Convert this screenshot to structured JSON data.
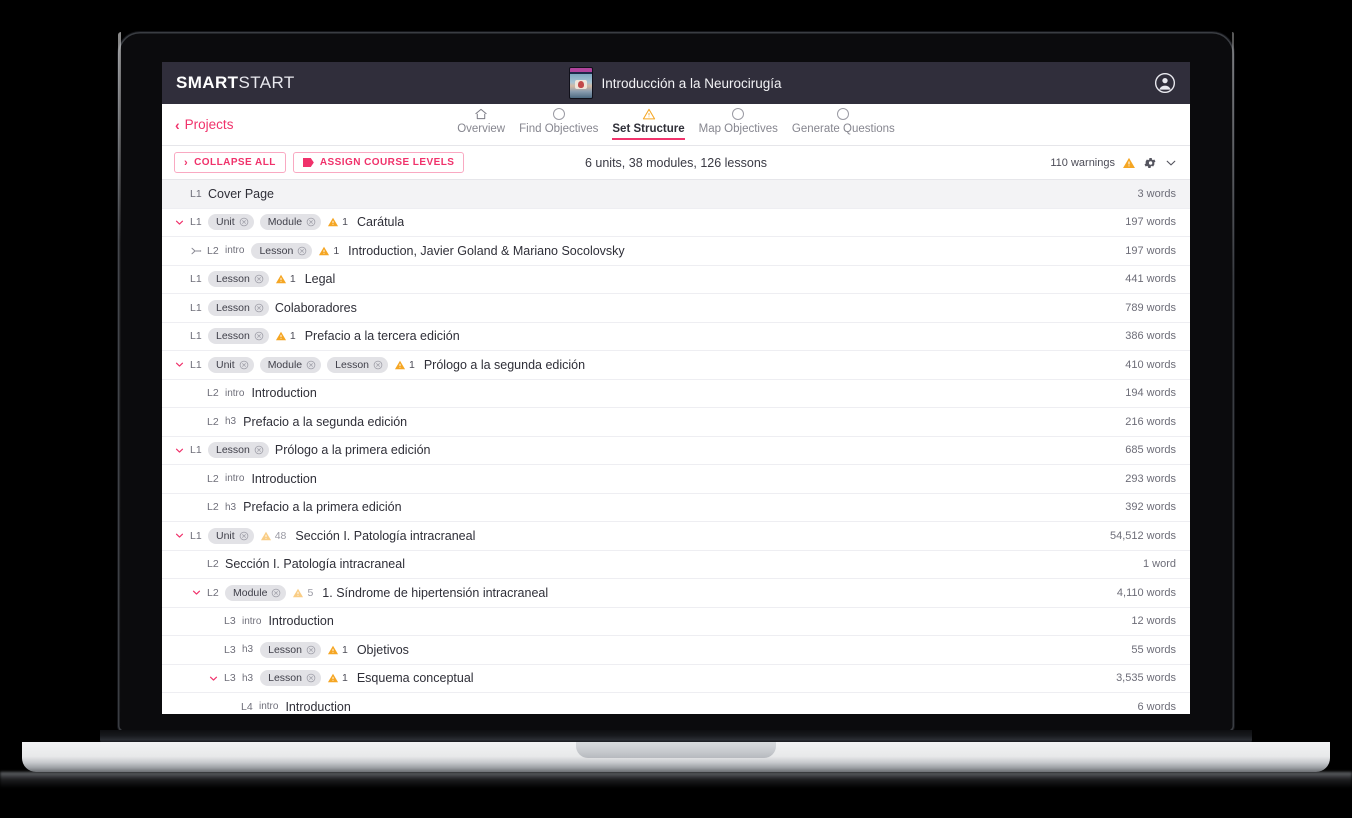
{
  "app": {
    "brand_strong": "SMART",
    "brand_light": "START",
    "course_title": "Introducción a la Neurocirugía",
    "account_icon": "account-circle-icon",
    "book_thumb_icon": "book-cover-thumbnail"
  },
  "nav": {
    "back_label": "Projects",
    "back_chevron": "‹",
    "steps": [
      {
        "label": "Overview",
        "icon": "home-icon",
        "state": "done"
      },
      {
        "label": "Find Objectives",
        "icon": "circle-icon",
        "state": "idle"
      },
      {
        "label": "Set Structure",
        "icon": "warning-triangle-icon",
        "state": "active"
      },
      {
        "label": "Map Objectives",
        "icon": "circle-icon",
        "state": "idle"
      },
      {
        "label": "Generate Questions",
        "icon": "circle-icon",
        "state": "idle"
      }
    ]
  },
  "toolbar": {
    "collapse_all_label": "COLLAPSE ALL",
    "collapse_chevron": "›",
    "assign_levels_label": "ASSIGN COURSE LEVELS",
    "assign_icon": "tag-icon",
    "summary": "6 units, 38 modules, 126 lessons",
    "warnings_label": "110 warnings",
    "warning_icon": "warning-triangle-icon",
    "settings_icon": "gear-icon",
    "collapse_panel_icon": "chevron-down-icon"
  },
  "colors": {
    "brand_pink": "#f0326b",
    "topbar": "#302e3b",
    "warning_orange": "#f5a623",
    "chip_bg": "#e2e2e6",
    "row_shaded": "#f3f3f5"
  },
  "tree": {
    "rows": [
      {
        "expander": "none",
        "indent": 0,
        "level": "L1",
        "htag": "",
        "chips": [],
        "warn": null,
        "title": "Cover Page",
        "words": "3 words",
        "shaded": true
      },
      {
        "expander": "open",
        "indent": 0,
        "level": "L1",
        "htag": "",
        "chips": [
          "Unit",
          "Module"
        ],
        "warn": {
          "n": "1",
          "dim": false
        },
        "title": "Carátula",
        "words": "197 words",
        "shaded": false
      },
      {
        "expander": "drag",
        "indent": 1,
        "level": "L2",
        "htag": "intro",
        "chips": [
          "Lesson"
        ],
        "warn": {
          "n": "1",
          "dim": false
        },
        "title": "Introduction, Javier Goland & Mariano Socolovsky",
        "words": "197 words",
        "shaded": false
      },
      {
        "expander": "none",
        "indent": 0,
        "level": "L1",
        "htag": "",
        "chips": [
          "Lesson"
        ],
        "warn": {
          "n": "1",
          "dim": false
        },
        "title": "Legal",
        "words": "441 words",
        "shaded": false
      },
      {
        "expander": "none",
        "indent": 0,
        "level": "L1",
        "htag": "",
        "chips": [
          "Lesson"
        ],
        "warn": null,
        "title": "Colaboradores",
        "words": "789 words",
        "shaded": false
      },
      {
        "expander": "none",
        "indent": 0,
        "level": "L1",
        "htag": "",
        "chips": [
          "Lesson"
        ],
        "warn": {
          "n": "1",
          "dim": false
        },
        "title": "Prefacio a la tercera edición",
        "words": "386 words",
        "shaded": false
      },
      {
        "expander": "open",
        "indent": 0,
        "level": "L1",
        "htag": "",
        "chips": [
          "Unit",
          "Module",
          "Lesson"
        ],
        "warn": {
          "n": "1",
          "dim": false
        },
        "title": "Prólogo a la segunda edición",
        "words": "410 words",
        "shaded": false
      },
      {
        "expander": "none",
        "indent": 1,
        "level": "L2",
        "htag": "intro",
        "chips": [],
        "warn": null,
        "title": "Introduction",
        "words": "194 words",
        "shaded": false
      },
      {
        "expander": "none",
        "indent": 1,
        "level": "L2",
        "htag": "h3",
        "chips": [],
        "warn": null,
        "title": "Prefacio a la segunda edición",
        "words": "216 words",
        "shaded": false
      },
      {
        "expander": "open",
        "indent": 0,
        "level": "L1",
        "htag": "",
        "chips": [
          "Lesson"
        ],
        "warn": null,
        "title": "Prólogo a la primera edición",
        "words": "685 words",
        "shaded": false
      },
      {
        "expander": "none",
        "indent": 1,
        "level": "L2",
        "htag": "intro",
        "chips": [],
        "warn": null,
        "title": "Introduction",
        "words": "293 words",
        "shaded": false
      },
      {
        "expander": "none",
        "indent": 1,
        "level": "L2",
        "htag": "h3",
        "chips": [],
        "warn": null,
        "title": "Prefacio a la primera edición",
        "words": "392 words",
        "shaded": false
      },
      {
        "expander": "open",
        "indent": 0,
        "level": "L1",
        "htag": "",
        "chips": [
          "Unit"
        ],
        "warn": {
          "n": "48",
          "dim": true
        },
        "title": "Sección I. Patología intracraneal",
        "words": "54,512 words",
        "shaded": false
      },
      {
        "expander": "none",
        "indent": 1,
        "level": "L2",
        "htag": "",
        "chips": [],
        "warn": null,
        "title": "Sección I. Patología intracraneal",
        "words": "1 word",
        "shaded": false
      },
      {
        "expander": "open",
        "indent": 1,
        "level": "L2",
        "htag": "",
        "chips": [
          "Module"
        ],
        "warn": {
          "n": "5",
          "dim": true
        },
        "title": "1. Síndrome de hipertensión intracraneal",
        "words": "4,110 words",
        "shaded": false
      },
      {
        "expander": "none",
        "indent": 2,
        "level": "L3",
        "htag": "intro",
        "chips": [],
        "warn": null,
        "title": "Introduction",
        "words": "12 words",
        "shaded": false
      },
      {
        "expander": "none",
        "indent": 2,
        "level": "L3",
        "htag": "h3",
        "chips": [
          "Lesson"
        ],
        "warn": {
          "n": "1",
          "dim": false
        },
        "title": "Objetivos",
        "words": "55 words",
        "shaded": false
      },
      {
        "expander": "open",
        "indent": 2,
        "level": "L3",
        "htag": "h3",
        "chips": [
          "Lesson"
        ],
        "warn": {
          "n": "1",
          "dim": false
        },
        "title": "Esquema conceptual",
        "words": "3,535 words",
        "shaded": false
      },
      {
        "expander": "none",
        "indent": 3,
        "level": "L4",
        "htag": "intro",
        "chips": [],
        "warn": null,
        "title": "Introduction",
        "words": "6 words",
        "shaded": false
      }
    ]
  }
}
